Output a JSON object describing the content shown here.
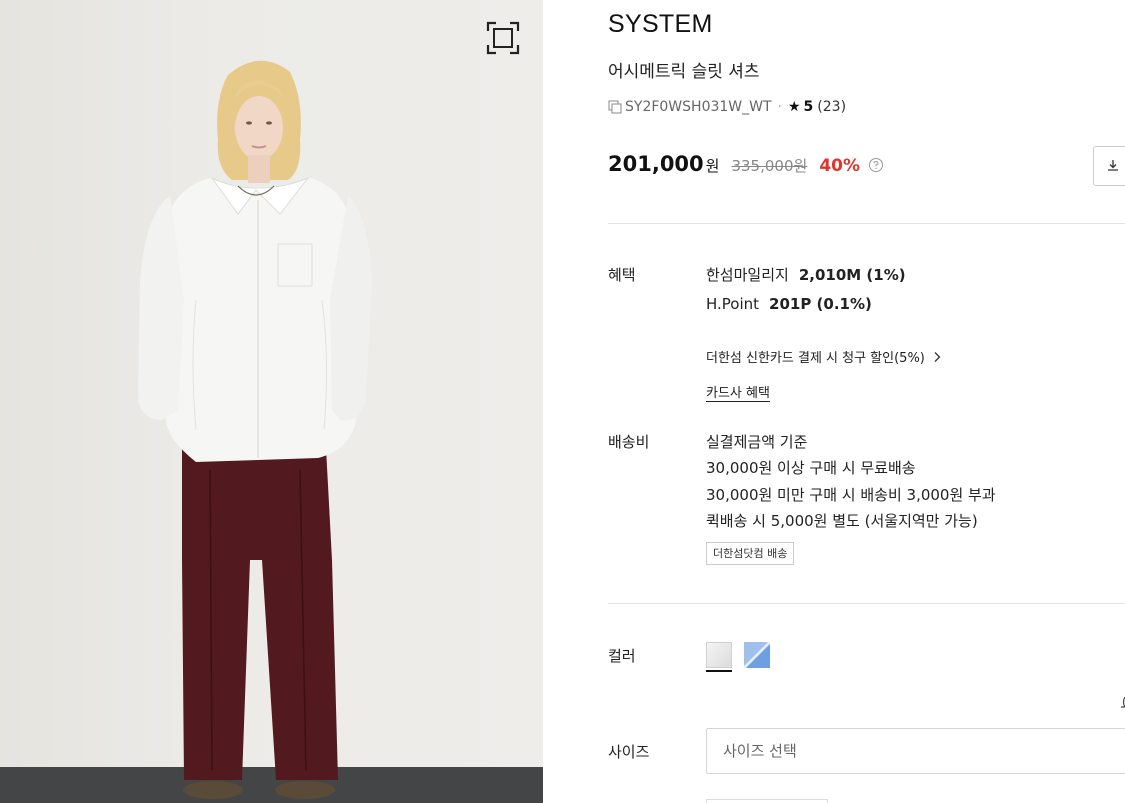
{
  "product": {
    "brand": "SYSTEM",
    "name": "어시메트릭 슬릿 셔츠",
    "code": "SY2F0WSH031W_WT",
    "rating": "5",
    "review_count": "(23)",
    "price": "201,000",
    "currency": "원",
    "original_price": "335,000원",
    "discount": "40%"
  },
  "benefits": {
    "label": "혜택",
    "mileage_label": "한섬마일리지",
    "mileage_value": "2,010M (1%)",
    "hpoint_label": "H.Point",
    "hpoint_value": "201P (0.1%)",
    "card_promo": "더한섬 신한카드 결제 시 청구 할인(5%)",
    "card_link": "카드사 혜택"
  },
  "shipping": {
    "label": "배송비",
    "lines": [
      "실결제금액 기준",
      "30,000원 이상 구매 시 무료배송",
      "30,000원 미만 구매 시 배송비 3,000원 부과",
      "퀵배송 시 5,000원 별도 (서울지역만 가능)"
    ],
    "tag": "더한섬닷컴 배송"
  },
  "options": {
    "color_label": "컬러",
    "colors": [
      {
        "name": "white",
        "hex": "#e6e6e6",
        "selected": true
      },
      {
        "name": "blue",
        "hex": "#8fb4e8",
        "selected": false
      }
    ],
    "size_label": "사이즈",
    "size_placeholder": "사이즈 선택"
  },
  "icons": {
    "zoom": "fullscreen-icon",
    "copy": "copy-icon",
    "help": "help-icon",
    "download": "download-icon"
  },
  "colors": {
    "discount": "#e4322c",
    "text": "#111111",
    "divider": "#e3e3e3"
  }
}
